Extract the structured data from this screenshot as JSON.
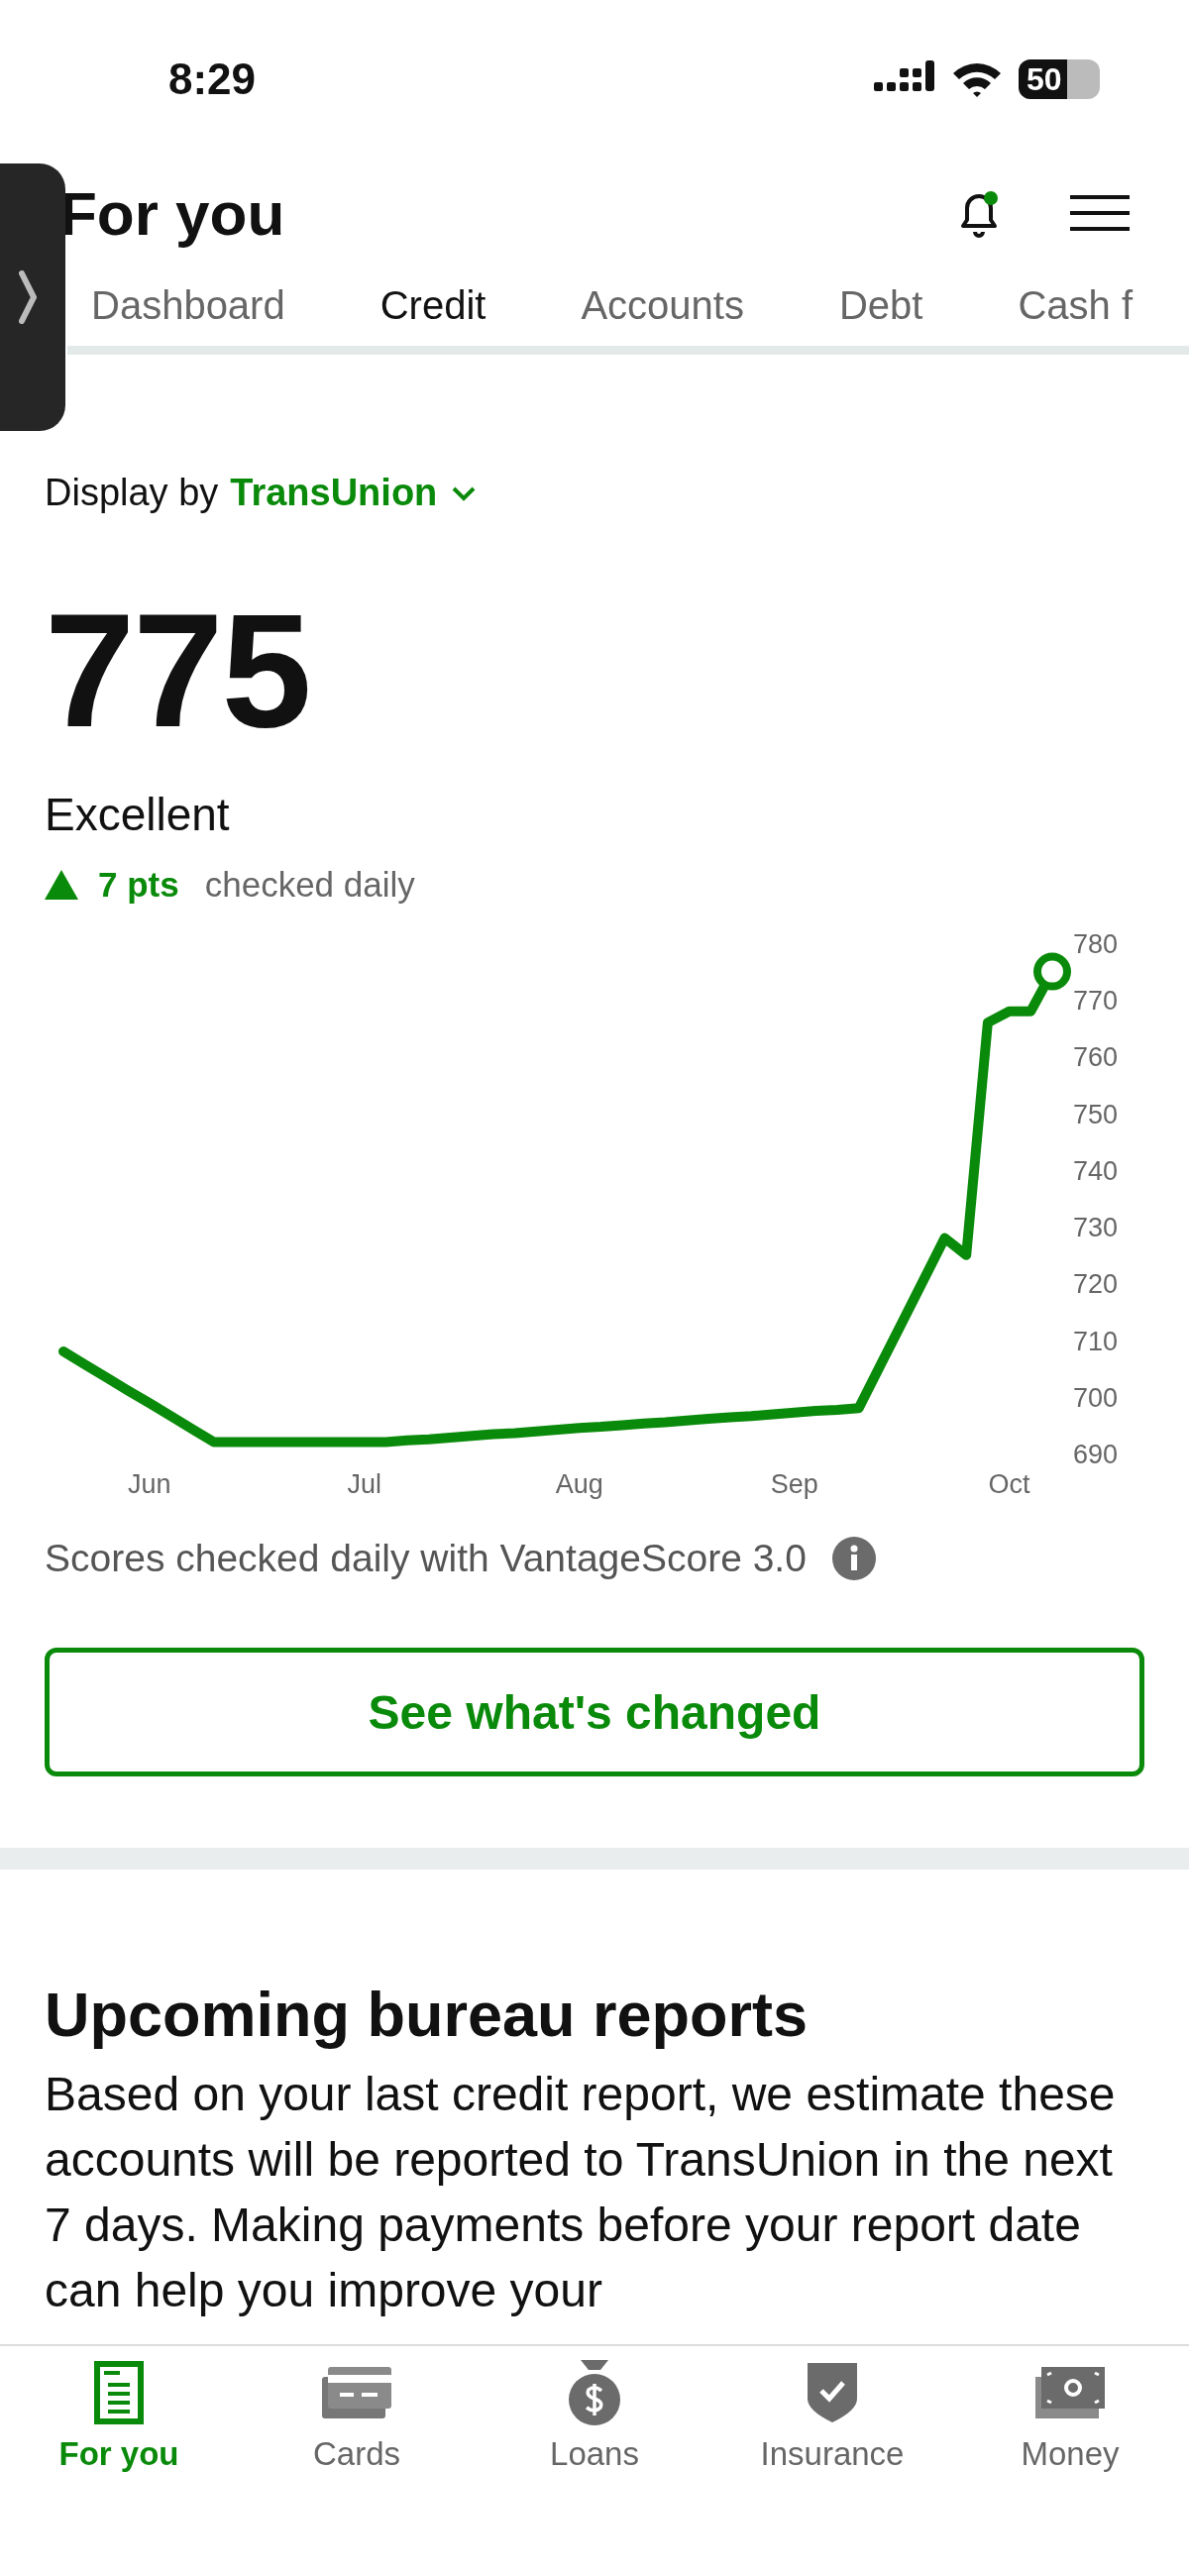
{
  "status_bar": {
    "time": "8:29",
    "battery": "50"
  },
  "header": {
    "title": "For you",
    "notification_dot": true
  },
  "tabs": [
    {
      "label": "Dashboard",
      "selected": false
    },
    {
      "label": "Credit",
      "selected": true
    },
    {
      "label": "Accounts",
      "selected": false
    },
    {
      "label": "Debt",
      "selected": false
    },
    {
      "label": "Cash f",
      "selected": false
    }
  ],
  "display_by": {
    "label": "Display by",
    "bureau": "TransUnion"
  },
  "score": {
    "value": "775",
    "rating": "Excellent",
    "change": "7 pts",
    "frequency": "checked daily"
  },
  "chart_data": {
    "type": "line",
    "categories": [
      null,
      null,
      null,
      null,
      "Jun",
      null,
      null,
      null,
      null,
      null,
      null,
      null,
      null,
      null,
      "Jul",
      null,
      null,
      null,
      null,
      null,
      null,
      null,
      null,
      null,
      "Aug",
      null,
      null,
      null,
      null,
      null,
      null,
      null,
      null,
      null,
      "Sep",
      null,
      null,
      null,
      null,
      null,
      null,
      null,
      null,
      null,
      "Oct",
      null,
      null
    ],
    "series": [
      {
        "color": "#0a8a0a",
        "values": [
          708,
          705.7,
          703.4,
          701.1,
          698.9,
          696.6,
          694.3,
          692,
          692,
          692,
          692,
          692,
          692,
          692,
          692,
          692,
          692.3,
          692.5,
          692.8,
          693.1,
          693.4,
          693.6,
          693.9,
          694.2,
          694.5,
          694.7,
          695,
          695.3,
          695.5,
          695.8,
          696.1,
          696.4,
          696.6,
          696.9,
          697.2,
          697.5,
          697.7,
          698,
          705.5,
          713,
          720.5,
          728,
          725,
          766,
          768,
          768,
          775
        ]
      }
    ],
    "ylim": [
      690,
      780
    ],
    "yticks": [
      690,
      700,
      710,
      720,
      730,
      740,
      750,
      760,
      770,
      780
    ]
  },
  "footnote": "Scores checked daily with VantageScore 3.0",
  "button": "See what's changed",
  "upcoming": {
    "title": "Upcoming bureau reports",
    "text": "Based on your last credit report, we estimate these accounts will be reported to TransUnion in the next 7 days. Making payments before your report date can help you improve your"
  },
  "bottom_nav": [
    {
      "label": "For you",
      "selected": true
    },
    {
      "label": "Cards",
      "selected": false
    },
    {
      "label": "Loans",
      "selected": false
    },
    {
      "label": "Insurance",
      "selected": false
    },
    {
      "label": "Money",
      "selected": false
    }
  ]
}
